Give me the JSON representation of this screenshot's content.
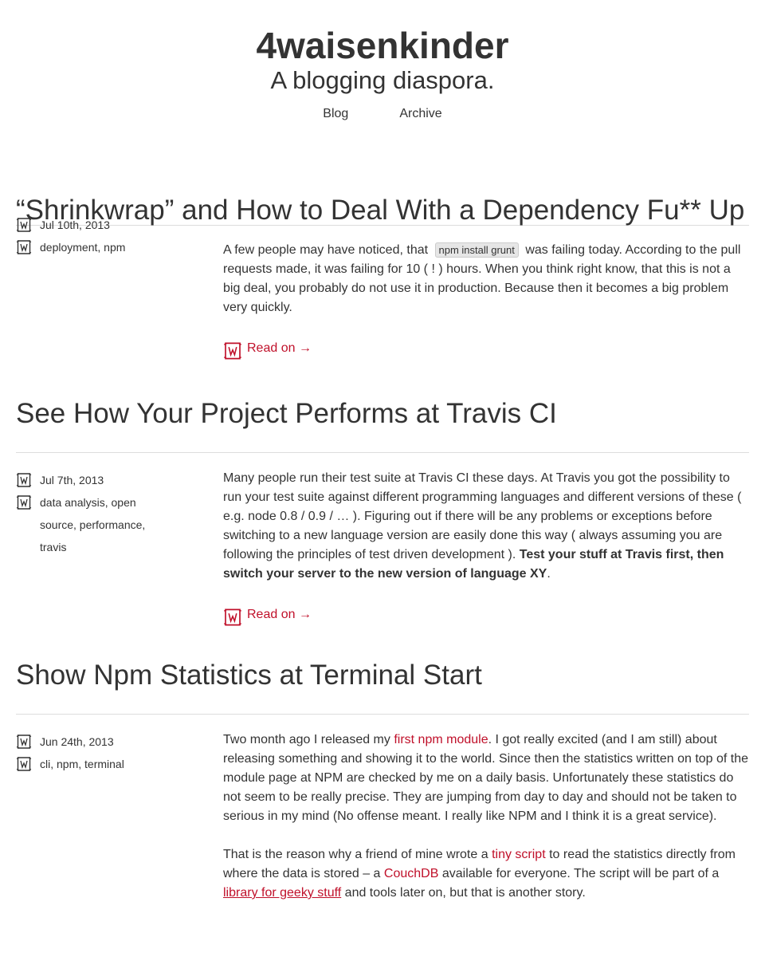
{
  "site": {
    "title": "4waisenkinder",
    "tagline": "A blogging diaspora.",
    "nav": [
      "Blog",
      "Archive"
    ]
  },
  "read_on_label": "Read on →",
  "posts": [
    {
      "title": "“Shrinkwrap” and How to Deal With a Dependency Fu** Up",
      "date": "Jul 10th, 2013",
      "tags": "deployment, npm",
      "excerpt": {
        "t1": "A few people may have noticed, that ",
        "code": "npm install grunt",
        "t2": " was failing today. According to the pull requests made, it was failing for 10 ( ! ) hours. When you think right know, that this is not a big deal, you probably do not use it in production. Because then it becomes a big problem very quickly."
      }
    },
    {
      "title": "See How Your Project Performs at Travis CI",
      "date": "Jul 7th, 2013",
      "tags": "data analysis, open source, performance, travis",
      "excerpt": {
        "t1": "Many people run their test suite at Travis CI these days. At Travis you got the possibility to run your test suite against different programming languages and different versions of these ( e.g. node 0.8 / 0.9 / … ). Figuring out if there will be any problems or exceptions before switching to a new language version are easily done this way ( always assuming you are following the principles of test driven development ). ",
        "bold": "Test your stuff at Travis first, then switch your server to the new version of language XY",
        "t2": "."
      }
    },
    {
      "title": "Show Npm Statistics at Terminal Start",
      "date": "Jun 24th, 2013",
      "tags": "cli, npm, terminal",
      "p1": {
        "t1": "Two month ago I released my ",
        "link1": "first npm module",
        "t2": ". I got really excited (and I am still) about releasing something and showing it to the world. Since then the statistics written on top of the module page at NPM are checked by me on a daily basis. Unfortunately these statistics do not seem to be really precise. They are jumping from day to day and should not be taken to serious in my mind (No offense meant. I really like NPM and I think it is a great service)."
      },
      "p2": {
        "t1": "That is the reason why a friend of mine wrote a ",
        "link1": "tiny script",
        "t2": " to read the statistics directly from where the data is stored – a ",
        "link2": "CouchDB",
        "t3": " available for everyone. The script will be part of a ",
        "link3": "library for geeky stuff",
        "t4": " and tools later on, but that is another story."
      }
    }
  ],
  "colors": {
    "accent": "#c0102a",
    "text": "#333333",
    "divider": "#dddddd"
  }
}
